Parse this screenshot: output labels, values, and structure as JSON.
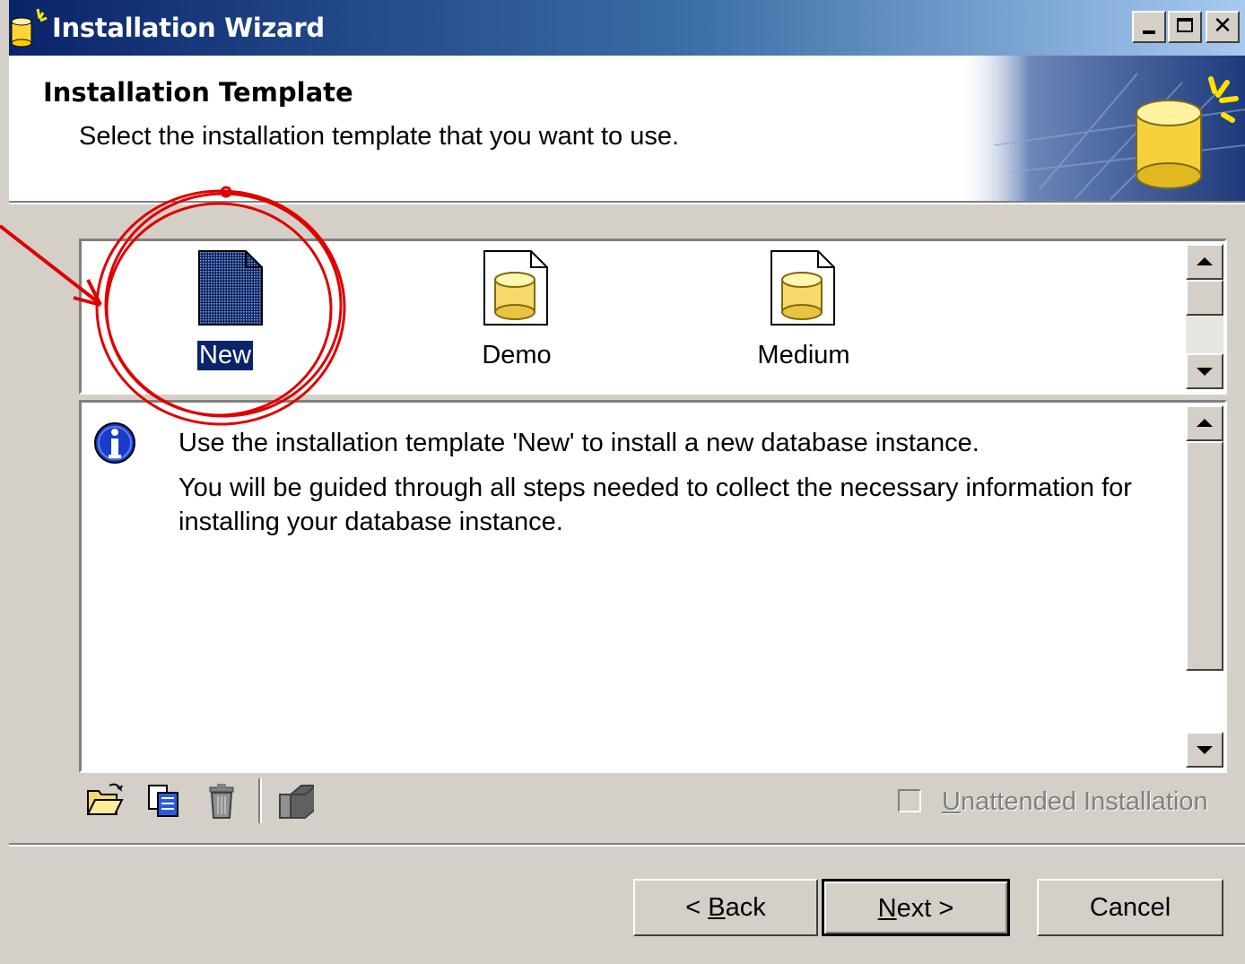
{
  "window": {
    "title": "Installation Wizard"
  },
  "header": {
    "title": "Installation Template",
    "subtitle": "Select the installation template that you want to use."
  },
  "templates": [
    {
      "label": "New",
      "icon": "blank-document-icon",
      "selected": true
    },
    {
      "label": "Demo",
      "icon": "database-document-icon",
      "selected": false
    },
    {
      "label": "Medium",
      "icon": "database-document-icon",
      "selected": false
    }
  ],
  "description": {
    "icon": "info-icon",
    "line1": "Use the installation template 'New' to install a new database instance.",
    "line2": "You will be guided through all steps needed to collect the necessary information for",
    "line3": "installing your database instance."
  },
  "toolbar": {
    "icons": [
      "open-folder-icon",
      "copy-icon",
      "delete-icon",
      "properties-icon"
    ],
    "unattended": {
      "prefix": "U",
      "rest": "nattended Installation",
      "checked": false,
      "enabled": false
    }
  },
  "buttons": {
    "back": {
      "prefix": "< ",
      "mnemonic": "B",
      "rest": "ack"
    },
    "next": {
      "mnemonic": "N",
      "rest": "ext >"
    },
    "cancel": "Cancel"
  },
  "colors": {
    "titlebar_start": "#0a246a",
    "titlebar_end": "#a6caf0",
    "selection": "#0a246a",
    "annotation": "#e00000",
    "dialog_bg": "#d4d0c8"
  }
}
